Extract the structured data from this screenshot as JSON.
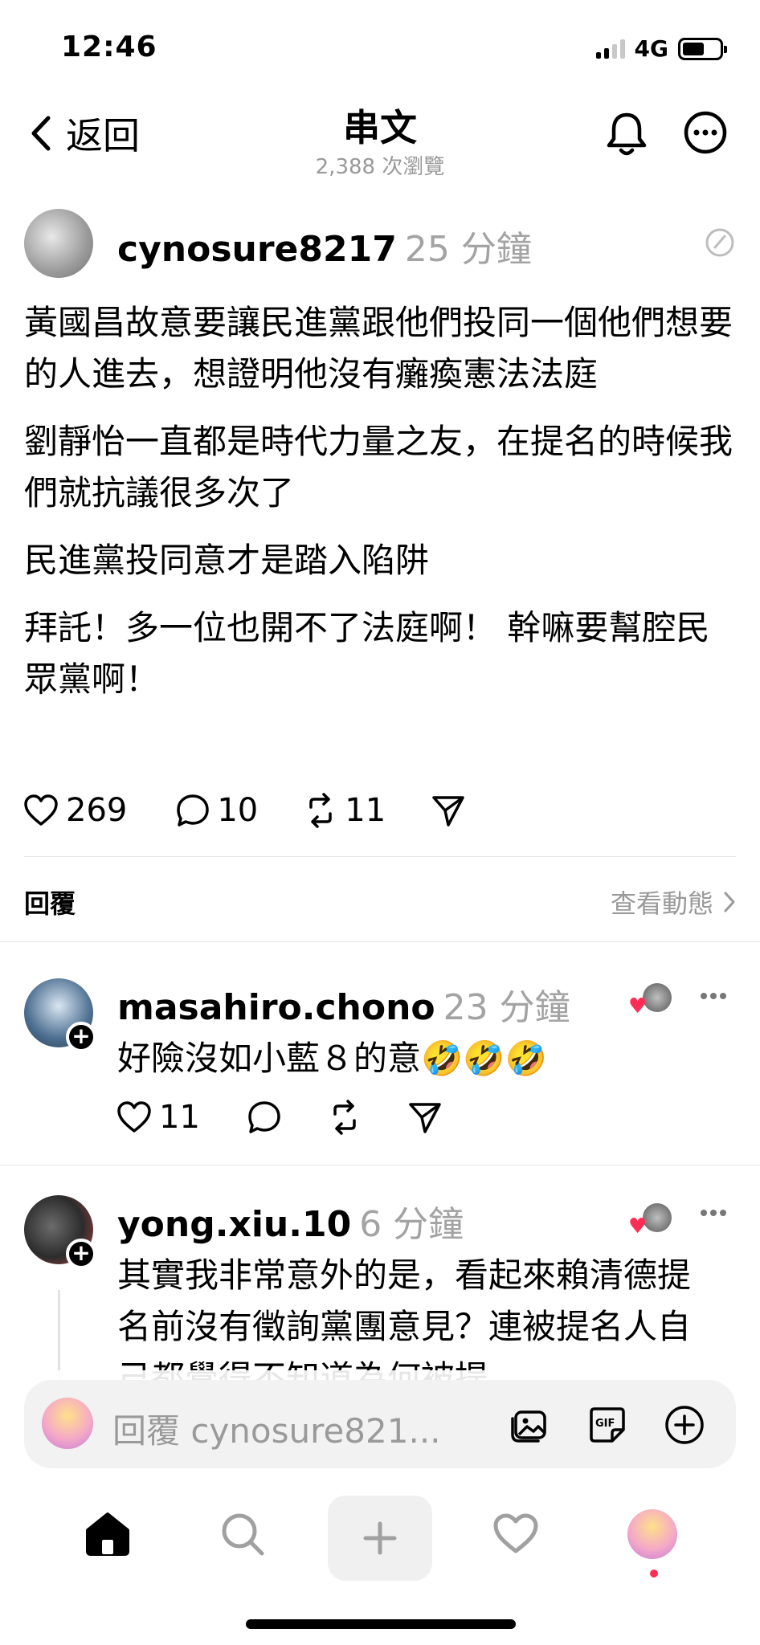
{
  "status_bar": {
    "time": "12:46",
    "network": "4G",
    "battery_level": 0.6
  },
  "header": {
    "back_label": "返回",
    "title": "串文",
    "views": "2,388 次瀏覽"
  },
  "post": {
    "username": "cynosure8217",
    "time_ago": "25 分鐘",
    "paragraphs": [
      "黃國昌故意要讓民進黨跟他們投同一個他們想要的人進去，想證明他沒有癱瘓憲法法庭",
      "劉靜怡一直都是時代力量之友，在提名的時候我們就抗議很多次了",
      "民進黨投同意才是踏入陷阱",
      "拜託！多一位也開不了法庭啊！ 幹嘛要幫腔民眾黨啊！"
    ],
    "likes": "269",
    "comments": "10",
    "reposts": "11"
  },
  "replies_bar": {
    "label": "回覆",
    "activity_link": "查看動態"
  },
  "replies": [
    {
      "username": "masahiro.chono",
      "time_ago": "23 分鐘",
      "text": "好險沒如小藍８的意🤣🤣🤣",
      "likes": "11"
    },
    {
      "username": "yong.xiu.10",
      "time_ago": "6 分鐘",
      "text": "其實我非常意外的是，看起來賴清德提名前沒有徵詢黨團意見？連被提名人自己都覺得不知道為何被提"
    }
  ],
  "composer": {
    "placeholder": "回覆 cynosure821..."
  },
  "colors": {
    "accent_like": "#ff2d55",
    "muted": "#999999"
  },
  "icons": [
    "chevron-left-icon",
    "bell-icon",
    "more-icon",
    "edit-icon",
    "heart-icon",
    "comment-icon",
    "repost-icon",
    "share-icon",
    "image-icon",
    "gif-icon",
    "plus-circle-icon",
    "home-icon",
    "search-icon",
    "plus-icon",
    "heart-tab-icon"
  ]
}
